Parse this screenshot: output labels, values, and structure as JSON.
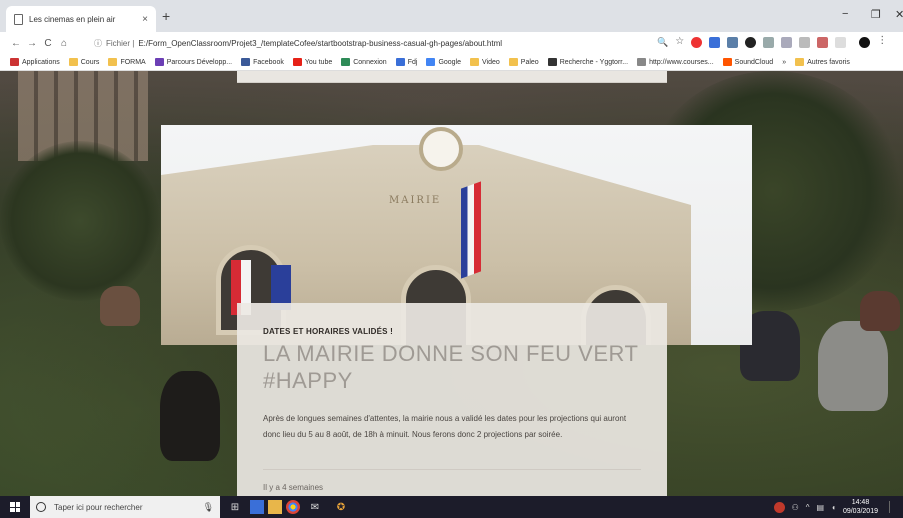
{
  "browser": {
    "tab_title": "Les cinemas en plein air",
    "tab_close": "×",
    "new_tab": "+",
    "minimize": "−",
    "restore": "❐",
    "close": "✕",
    "back": "←",
    "forward": "→",
    "reload": "C",
    "home": "⌂",
    "url_info": "ⓘ",
    "url_scheme": "Fichier |",
    "url": "E:/Form_OpenClassroom/Projet3_/templateCofee/startbootstrap-business-casual-gh-pages/about.html",
    "zoom_icon": "🔍",
    "star_icon": "☆",
    "menu_icon": "⋮"
  },
  "bookmarks": [
    {
      "label": "Applications",
      "color": "#c33"
    },
    {
      "label": "Cours",
      "color": "#f2c14e"
    },
    {
      "label": "FORMA",
      "color": "#f2c14e"
    },
    {
      "label": "Parcours Développ...",
      "color": "#6c3fb5"
    },
    {
      "label": "Facebook",
      "color": "#3b5998"
    },
    {
      "label": "You tube",
      "color": "#e62117"
    },
    {
      "label": "Connexion",
      "color": "#2e8b57"
    },
    {
      "label": "Fdj",
      "color": "#3a6fd8"
    },
    {
      "label": "Google",
      "color": "#4285f4"
    },
    {
      "label": "Video",
      "color": "#f2c14e"
    },
    {
      "label": "Paleo",
      "color": "#f2c14e"
    },
    {
      "label": "Recherche - Yggtorr...",
      "color": "#333"
    },
    {
      "label": "http://www.courses...",
      "color": "#888"
    },
    {
      "label": "SoundCloud",
      "color": "#ff5500"
    },
    {
      "label": "»",
      "color": ""
    },
    {
      "label": "Autres favoris",
      "color": "#f2c14e"
    }
  ],
  "page": {
    "mairie_sign": "MAIRIE",
    "kicker": "DATES ET HORAIRES VALIDÉS !",
    "headline": "LA MAIRIE DONNE SON FEU VERT #HAPPY",
    "body": "Après de longues semaines d'attentes, la mairie nous a validé les dates pour les projections qui auront donc lieu du 5 au 8 août, de 18h à minuit. Nous ferons donc 2 projections par soirée.",
    "meta": "Il y a 4 semaines"
  },
  "taskbar": {
    "search_placeholder": "Taper ici pour rechercher",
    "time": "14:48",
    "date": "09/03/2019"
  }
}
